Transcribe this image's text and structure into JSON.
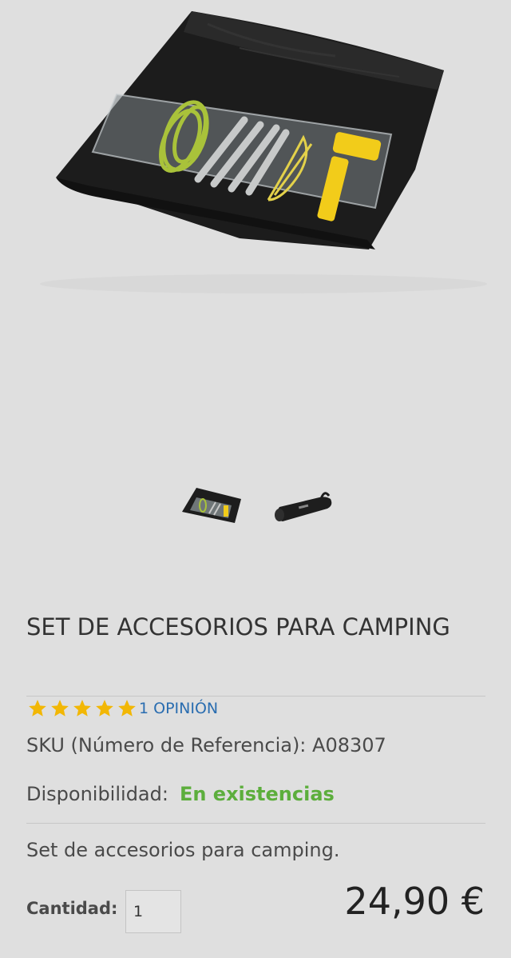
{
  "product": {
    "title": "SET DE ACCESORIOS PARA CAMPING",
    "rating_stars": 5,
    "reviews_link": "1 OPINIÓN",
    "sku_line": "SKU (Número de Referencia): A08307",
    "availability_label": "Disponibilidad:",
    "availability_value": "En existencias",
    "description": "Set de accesorios para camping.",
    "quantity_label": "Cantidad:",
    "quantity_value": "1",
    "price": "24,90 €"
  },
  "colors": {
    "background": "#dfdfdf",
    "star": "#f2b705",
    "link": "#2a6db0",
    "in_stock": "#5cae3c",
    "bag": "#1a1a1a",
    "hammer": "#f2cc1a",
    "rope": "#a9c23a"
  },
  "icons": {
    "star": "star-icon"
  }
}
